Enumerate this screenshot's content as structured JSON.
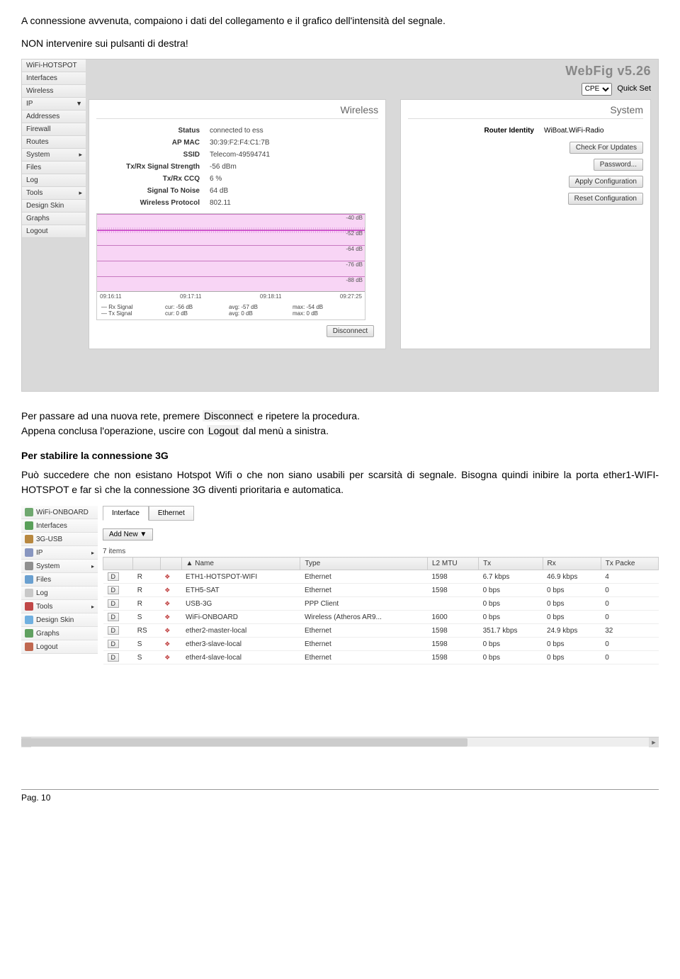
{
  "intro": {
    "line1": "A connessione avvenuta, compaiono i dati del collegamento e il grafico dell'intensità del segnale.",
    "line2": "NON intervenire sui pulsanti di destra!"
  },
  "webfig": {
    "brand": "WebFig v5.26",
    "quickset_select": "CPE",
    "quickset_label": "Quick Set",
    "sidebar": [
      {
        "label": "WiFi-HOTSPOT"
      },
      {
        "label": "Interfaces"
      },
      {
        "label": "Wireless"
      },
      {
        "label": "IP",
        "arrow": "▼"
      },
      {
        "label": "Addresses"
      },
      {
        "label": "Firewall"
      },
      {
        "label": "Routes"
      },
      {
        "label": "System",
        "arrow": "▸"
      },
      {
        "label": "Files"
      },
      {
        "label": "Log"
      },
      {
        "label": "Tools",
        "arrow": "▸"
      },
      {
        "label": "Design Skin"
      },
      {
        "label": "Graphs"
      },
      {
        "label": "Logout"
      }
    ],
    "wireless": {
      "title": "Wireless",
      "rows": [
        {
          "k": "Status",
          "v": "connected to ess"
        },
        {
          "k": "AP MAC",
          "v": "30:39:F2:F4:C1:7B"
        },
        {
          "k": "SSID",
          "v": "Telecom-49594741"
        },
        {
          "k": "Tx/Rx Signal Strength",
          "v": "-56 dBm"
        },
        {
          "k": "Tx/Rx CCQ",
          "v": "6 %"
        },
        {
          "k": "Signal To Noise",
          "v": "64 dB"
        },
        {
          "k": "Wireless Protocol",
          "v": "802.11"
        }
      ],
      "chart": {
        "ticks": [
          "-40 dB",
          "-52 dB",
          "-64 dB",
          "-76 dB",
          "-88 dB"
        ],
        "times": [
          "09:16:11",
          "09:17:11",
          "09:18:11",
          "09:27:25"
        ],
        "legend": [
          {
            "name": "— Rx Signal",
            "cur": "cur: -56 dB",
            "avg": "avg: -57 dB",
            "max": "max: -54 dB"
          },
          {
            "name": "— Tx Signal",
            "cur": "cur: 0 dB",
            "avg": "avg: 0 dB",
            "max": "max: 0 dB"
          }
        ]
      },
      "disconnect": "Disconnect"
    },
    "system": {
      "title": "System",
      "identity_k": "Router Identity",
      "identity_v": "WiBoat.WiFi-Radio",
      "buttons": [
        "Check For Updates",
        "Password...",
        "Apply Configuration",
        "Reset Configuration"
      ]
    }
  },
  "chart_data": {
    "type": "line",
    "title": "Signal Strength",
    "ylabel": "dB",
    "ylim": [
      -100,
      -40
    ],
    "x": [
      "09:16:11",
      "09:17:11",
      "09:18:11",
      "09:27:25"
    ],
    "series": [
      {
        "name": "Rx Signal",
        "cur": -56,
        "avg": -57,
        "max": -54
      },
      {
        "name": "Tx Signal",
        "cur": 0,
        "avg": 0,
        "max": 0
      }
    ],
    "yticks": [
      -40,
      -52,
      -64,
      -76,
      -88
    ]
  },
  "mid": {
    "p1a": "Per passare ad una nuova rete, premere ",
    "p1_hl1": "Disconnect",
    "p1b": " e ripetere la procedura.",
    "p2a": "Appena conclusa l'operazione, uscire con ",
    "p2_hl1": "Logout",
    "p2b": " dal menù a sinistra.",
    "h": "Per stabilire la connessione 3G",
    "p3": "Può succedere che non esistano Hotspot Wifi o che non siano usabili per scarsità di segnale. Bisogna quindi inibire la porta ether1-WIFI-HOTSPOT e far sì che  la connessione 3G diventi prioritaria e automatica."
  },
  "interfaces": {
    "sidebar": [
      {
        "label": "WiFi-ONBOARD",
        "color": "#6fa86f"
      },
      {
        "label": "Interfaces",
        "color": "#5aa05a"
      },
      {
        "label": "3G-USB",
        "color": "#b88840"
      },
      {
        "label": "IP",
        "color": "#8896c0"
      },
      {
        "label": "System",
        "color": "#909090"
      },
      {
        "label": "Files",
        "color": "#6aa0d0"
      },
      {
        "label": "Log",
        "color": "#c8c8c8"
      },
      {
        "label": "Tools",
        "color": "#c04848"
      },
      {
        "label": "Design Skin",
        "color": "#70b0e0"
      },
      {
        "label": "Graphs",
        "color": "#60a060"
      },
      {
        "label": "Logout",
        "color": "#c06850"
      }
    ],
    "tabs": [
      "Interface",
      "Ethernet"
    ],
    "addnew": "Add New  ▼",
    "count": "7 items",
    "cols": [
      "",
      "",
      "",
      "▲ Name",
      "Type",
      "L2 MTU",
      "Tx",
      "Rx",
      "Tx Packe"
    ],
    "rows": [
      {
        "d": "D",
        "f": "R",
        "name": "ETH1-HOTSPOT-WIFI",
        "type": "Ethernet",
        "mtu": "1598",
        "tx": "6.7 kbps",
        "rx": "46.9 kbps",
        "txp": "4"
      },
      {
        "d": "D",
        "f": "R",
        "name": "ETH5-SAT",
        "type": "Ethernet",
        "mtu": "1598",
        "tx": "0 bps",
        "rx": "0 bps",
        "txp": "0"
      },
      {
        "d": "D",
        "f": "R",
        "name": "USB-3G",
        "type": "PPP Client",
        "mtu": "",
        "tx": "0 bps",
        "rx": "0 bps",
        "txp": "0"
      },
      {
        "d": "D",
        "f": "S",
        "name": "WiFi-ONBOARD",
        "type": "Wireless (Atheros AR9...",
        "mtu": "1600",
        "tx": "0 bps",
        "rx": "0 bps",
        "txp": "0"
      },
      {
        "d": "D",
        "f": "RS",
        "name": "ether2-master-local",
        "type": "Ethernet",
        "mtu": "1598",
        "tx": "351.7 kbps",
        "rx": "24.9 kbps",
        "txp": "32"
      },
      {
        "d": "D",
        "f": "S",
        "name": "ether3-slave-local",
        "type": "Ethernet",
        "mtu": "1598",
        "tx": "0 bps",
        "rx": "0 bps",
        "txp": "0"
      },
      {
        "d": "D",
        "f": "S",
        "name": "ether4-slave-local",
        "type": "Ethernet",
        "mtu": "1598",
        "tx": "0 bps",
        "rx": "0 bps",
        "txp": "0"
      }
    ]
  },
  "footer": "Pag. 10"
}
